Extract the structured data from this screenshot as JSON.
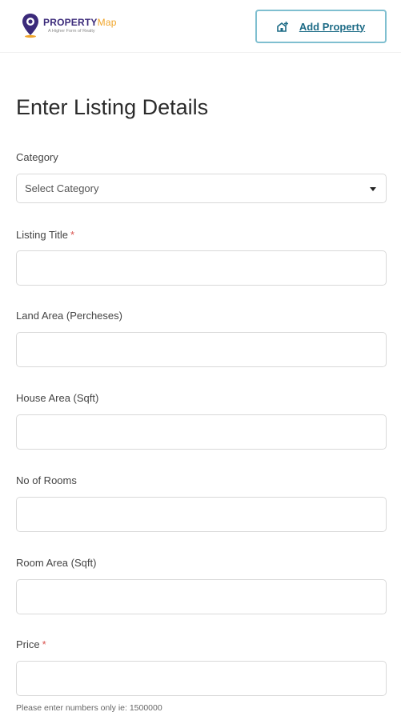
{
  "header": {
    "logo_main": "PROPERTY",
    "logo_accent": "Map",
    "logo_tagline": "A Higher Form of Realty",
    "add_property_label": "Add Property"
  },
  "form": {
    "title": "Enter Listing Details",
    "category": {
      "label": "Category",
      "placeholder": "Select Category"
    },
    "listing_title": {
      "label": "Listing Title",
      "required_mark": "*",
      "value": ""
    },
    "land_area": {
      "label": "Land Area (Percheses)",
      "value": ""
    },
    "house_area": {
      "label": "House Area (Sqft)",
      "value": ""
    },
    "rooms": {
      "label": "No of Rooms",
      "value": ""
    },
    "room_area": {
      "label": "Room Area (Sqft)",
      "value": ""
    },
    "price": {
      "label": "Price",
      "required_mark": "*",
      "value": "",
      "help": "Please enter numbers only ie: 1500000"
    }
  },
  "colors": {
    "brand_purple": "#3b2a7a",
    "brand_orange": "#f0a52a",
    "button_border": "#7fbfd0",
    "button_text": "#1d6b86",
    "required": "#d9534f"
  }
}
